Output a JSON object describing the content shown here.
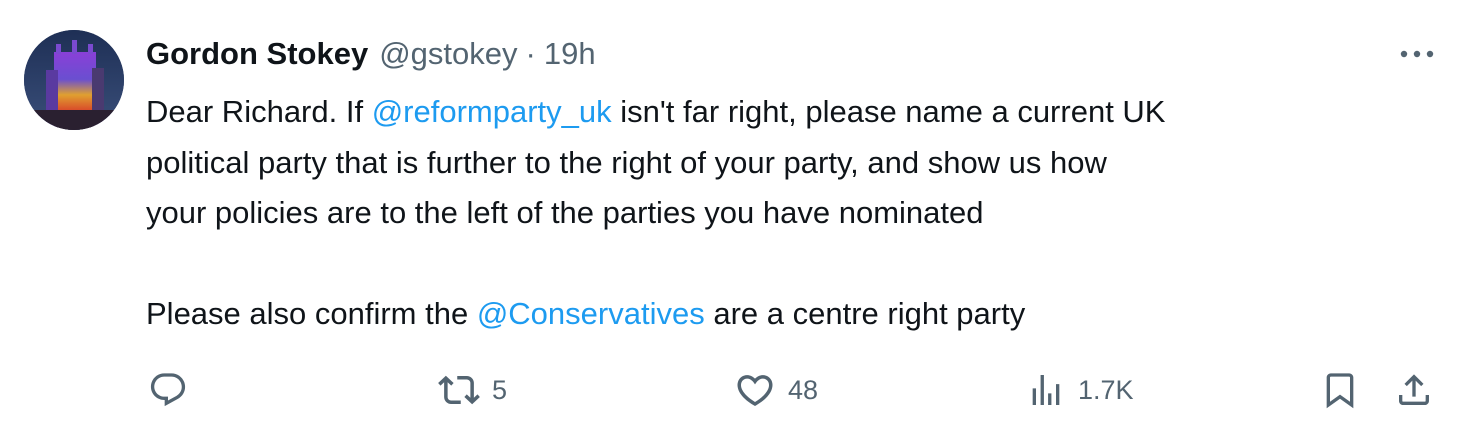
{
  "tweet": {
    "author_name": "Gordon Stokey",
    "author_handle": "@gstokey",
    "separator": "·",
    "time": "19h",
    "body": {
      "line1_pre": "Dear Richard. If ",
      "mention1": "@reformparty_uk",
      "line1_post": " isn't far right, please name a current UK",
      "line2": "political party that is further to the right of your party, and show us how",
      "line3": "your policies are to the left of the parties you have nominated",
      "line5_pre": "Please also confirm the ",
      "mention2": "@Conservatives",
      "line5_post": " are a centre right party"
    }
  },
  "actions": {
    "reply": {
      "icon": "reply-icon",
      "count": ""
    },
    "retweet": {
      "icon": "retweet-icon",
      "count": "5"
    },
    "like": {
      "icon": "heart-icon",
      "count": "48"
    },
    "views": {
      "icon": "views-chart-icon",
      "count": "1.7K"
    },
    "bookmark": {
      "icon": "bookmark-icon"
    },
    "share": {
      "icon": "share-icon"
    }
  },
  "colors": {
    "text": "#0f1419",
    "secondary": "#536471",
    "link": "#1d9bf0"
  }
}
